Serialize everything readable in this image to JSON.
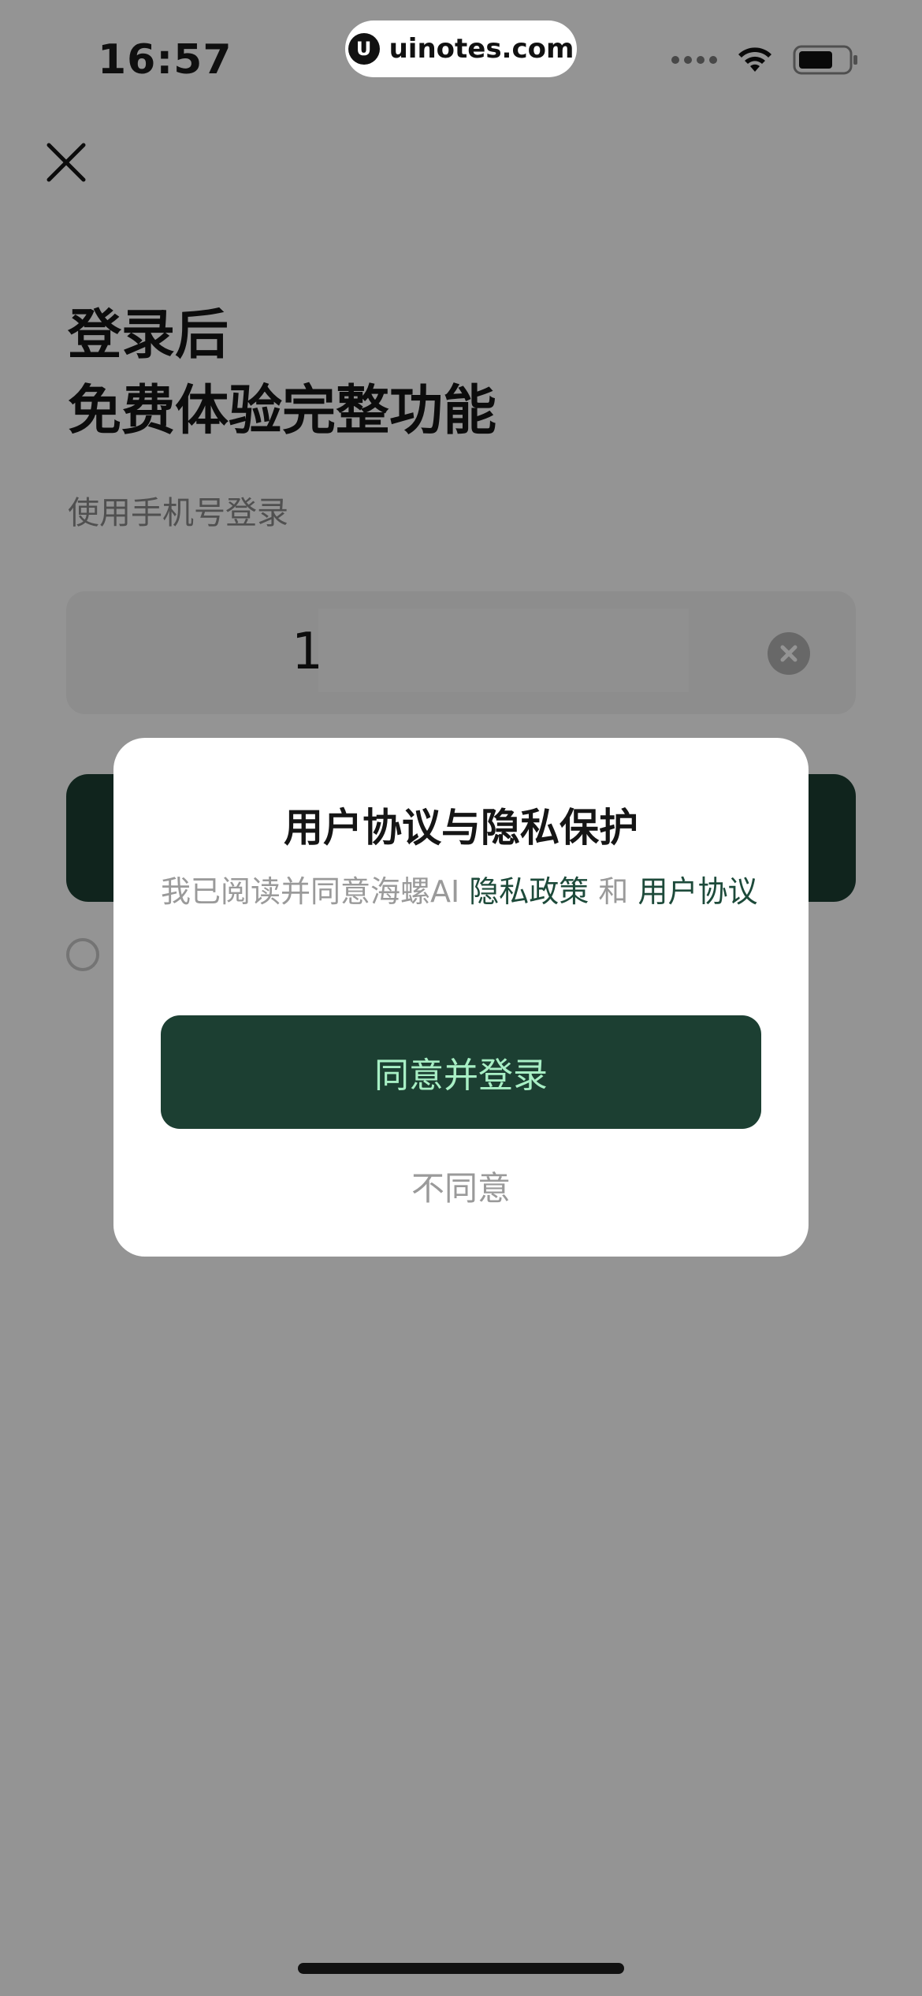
{
  "status_bar": {
    "time": "16:57",
    "url": "uinotes.com",
    "icons": [
      "signal-icon",
      "wifi-icon",
      "battery-icon"
    ]
  },
  "page": {
    "close_icon": "close-icon",
    "headline_line1": "登录后",
    "headline_line2": "免费体验完整功能",
    "subtitle": "使用手机号登录",
    "phone_prefix": "1",
    "phone_value": "",
    "clear_icon": "clear-icon"
  },
  "dialog": {
    "title": "用户协议与隐私保护",
    "body_prefix": "我已阅读并同意海螺AI ",
    "privacy_link": "隐私政策",
    "conjunction": " 和 ",
    "terms_link": "用户协议",
    "agree_button": "同意并登录",
    "disagree_button": "不同意"
  },
  "colors": {
    "accent": "#1c3f32",
    "accent_text": "#a8efc5",
    "link": "#1d4a3a",
    "muted": "#9a9a9a"
  }
}
